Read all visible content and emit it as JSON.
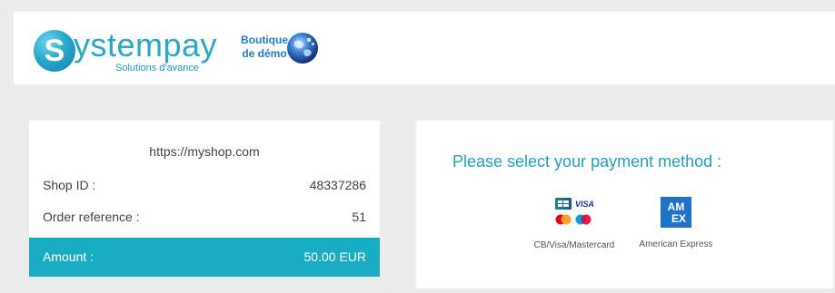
{
  "header": {
    "logo_letter": "S",
    "logo_word": "ystempay",
    "logo_tagline": "Solutions d'avance",
    "shop_badge_line1": "Boutique",
    "shop_badge_line2": "de démo"
  },
  "summary": {
    "shop_url": "https://myshop.com",
    "shop_id_label": "Shop ID :",
    "shop_id_value": "48337286",
    "order_ref_label": "Order reference :",
    "order_ref_value": "51",
    "amount_label": "Amount :",
    "amount_value": "50.00 EUR"
  },
  "payment": {
    "title": "Please select your payment method :",
    "methods": [
      {
        "label": "CB/Visa/Mastercard",
        "icon": "cb-visa-mastercard-icon"
      },
      {
        "label": "American Express",
        "icon": "amex-icon"
      }
    ]
  },
  "colors": {
    "accent": "#19adc3",
    "brand_blue": "#2aa7c9",
    "title_blue": "#1fa3bd",
    "background": "#ececec"
  }
}
